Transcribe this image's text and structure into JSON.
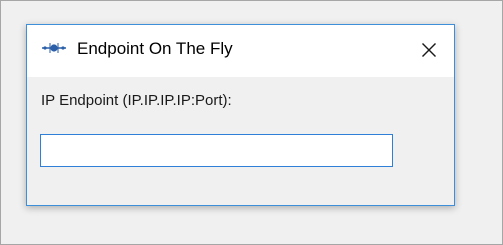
{
  "dialog": {
    "title": "Endpoint On The Fly",
    "icon": "network-hub-icon",
    "close_glyph": "✕"
  },
  "form": {
    "label": "IP Endpoint (IP.IP.IP.IP:Port):",
    "value": "",
    "placeholder": ""
  },
  "colors": {
    "accent_border": "#3c8fd8",
    "input_border": "#2f7ed8",
    "content_bg": "#f0f0f0",
    "backdrop": "#f0f0f0"
  }
}
